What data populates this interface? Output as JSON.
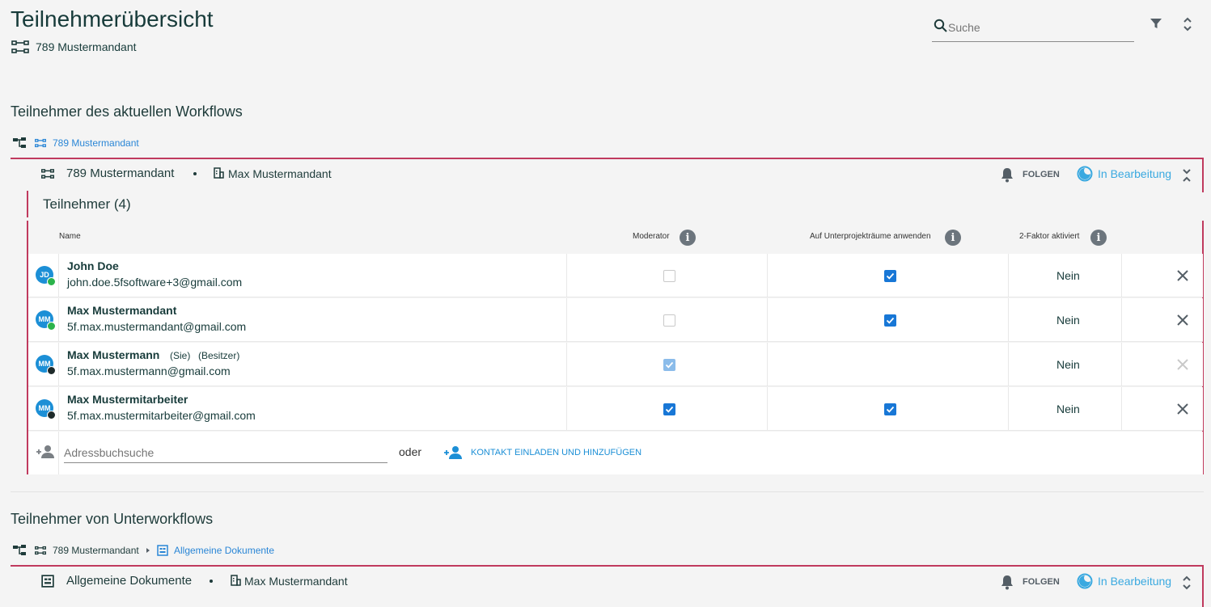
{
  "header": {
    "title": "Teilnehmerübersicht",
    "tenant": "789 Mustermandant",
    "search_placeholder": "Suche"
  },
  "current": {
    "section_title": "Teilnehmer des aktuellen Workflows",
    "breadcrumb_link": "789 Mustermandant",
    "workflow": {
      "title": "789 Mustermandant",
      "owner": "Max Mustermandant",
      "follow_label": "FOLGEN",
      "status": "In Bearbeitung"
    },
    "participants_heading": "Teilnehmer (4)",
    "columns": {
      "name": "Name",
      "moderator": "Moderator",
      "apply_sub": "Auf Unterprojekträume anwenden",
      "twofactor": "2-Faktor aktiviert"
    },
    "rows": [
      {
        "initials": "JD",
        "name": "John Doe",
        "email": "john.doe.5fsoftware+3@gmail.com",
        "tags": "",
        "moderator": "unchecked",
        "apply_sub": "checked",
        "twofactor": "Nein",
        "badge": "green"
      },
      {
        "initials": "MM",
        "name": "Max Mustermandant",
        "email": "5f.max.mustermandant@gmail.com",
        "tags": "",
        "moderator": "unchecked",
        "apply_sub": "checked",
        "twofactor": "Nein",
        "badge": "green"
      },
      {
        "initials": "MM",
        "name": "Max Mustermann",
        "email": "5f.max.mustermann@gmail.com",
        "tag1": "(Sie)",
        "tag2": "(Besitzer)",
        "moderator": "checked-disabled",
        "apply_sub": "none",
        "twofactor": "Nein",
        "badge": "dark"
      },
      {
        "initials": "MM",
        "name": "Max Mustermitarbeiter",
        "email": "5f.max.mustermitarbeiter@gmail.com",
        "tags": "",
        "moderator": "checked",
        "apply_sub": "checked",
        "twofactor": "Nein",
        "badge": "dark"
      }
    ],
    "address_placeholder": "Adressbuchsuche",
    "oder": "oder",
    "invite_label": "KONTAKT EINLADEN UND HINZUFÜGEN"
  },
  "sub": {
    "section_title": "Teilnehmer von Unterworkflows",
    "breadcrumb_1": "789 Mustermandant",
    "breadcrumb_2": "Allgemeine Dokumente",
    "workflow": {
      "title": "Allgemeine Dokumente",
      "owner": "Max Mustermandant",
      "follow_label": "FOLGEN",
      "status": "In Bearbeitung"
    }
  },
  "colors": {
    "accent": "#c03a5e",
    "link": "#2a86d6",
    "status": "#3aa9e0",
    "checkbox": "#1877d6"
  }
}
